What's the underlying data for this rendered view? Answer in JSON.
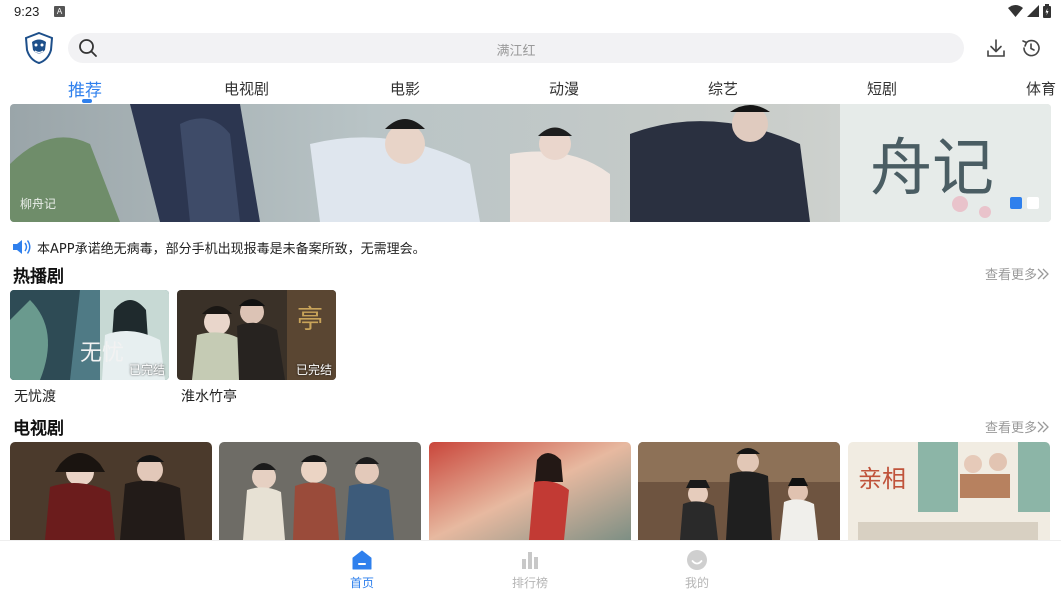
{
  "status_bar": {
    "time": "9:23",
    "notification_icon": "A"
  },
  "search": {
    "placeholder": "满江红"
  },
  "tabs": [
    {
      "label": "推荐",
      "active": true
    },
    {
      "label": "电视剧"
    },
    {
      "label": "电影"
    },
    {
      "label": "动漫"
    },
    {
      "label": "综艺"
    },
    {
      "label": "短剧"
    },
    {
      "label": "体育"
    }
  ],
  "banner": {
    "caption": "柳舟记",
    "active_slide": 1,
    "slide_count": 2,
    "title_art": "舟记"
  },
  "notice": {
    "text": "本APP承诺绝无病毒，部分手机出现报毒是未备案所致，无需理会。"
  },
  "hot_section": {
    "title": "热播剧",
    "more": "查看更多",
    "items": [
      {
        "name": "无忧渡",
        "badge": "已完结",
        "art": "无忧"
      },
      {
        "name": "淮水竹亭",
        "badge": "已完结",
        "art": "亭"
      }
    ]
  },
  "tv_section": {
    "title": "电视剧",
    "more": "查看更多",
    "card_art": "亲相"
  },
  "bottom_nav": [
    {
      "label": "首页",
      "icon": "home-icon",
      "active": true
    },
    {
      "label": "排行榜",
      "icon": "ranking-icon"
    },
    {
      "label": "我的",
      "icon": "profile-icon"
    }
  ],
  "colors": {
    "accent": "#2f80ed",
    "muted": "#9a9a9a"
  }
}
